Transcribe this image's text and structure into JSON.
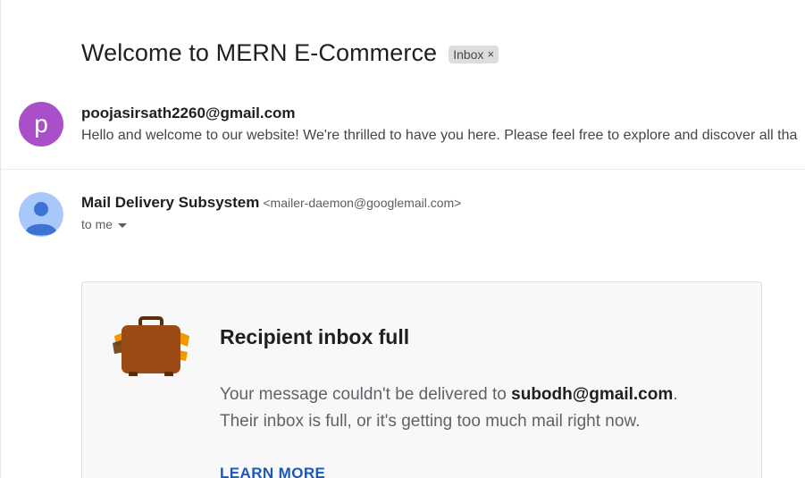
{
  "thread": {
    "subject": "Welcome to MERN E-Commerce",
    "label": "Inbox",
    "label_remove": "×"
  },
  "message1": {
    "avatar_letter": "p",
    "sender": "poojasirsath2260@gmail.com",
    "snippet": "Hello and welcome to our website! We're thrilled to have you here. Please feel free to explore and discover all tha"
  },
  "message2": {
    "sender_name": "Mail Delivery Subsystem",
    "sender_email": "<mailer-daemon@googlemail.com>",
    "to_label": "to me",
    "card": {
      "title": "Recipient inbox full",
      "body_prefix": "Your message couldn't be delivered to ",
      "recipient": "subodh@gmail.com",
      "body_suffix": ".",
      "body_line2": "Their inbox is full, or it's getting too much mail right now.",
      "link": "LEARN MORE"
    }
  },
  "colors": {
    "avatar_p": "#a950c8",
    "avatar_generic_bg": "#a8c7fa",
    "avatar_generic_fg": "#3d73d6",
    "link": "#1a57c0",
    "suitcase": "#9a4a12",
    "suitcase_accent": "#f29900"
  }
}
